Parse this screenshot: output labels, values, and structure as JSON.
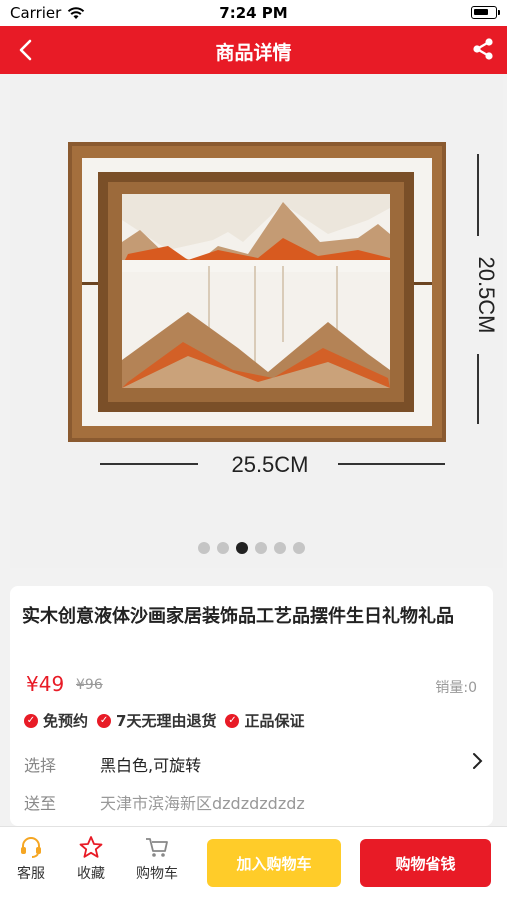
{
  "status_bar": {
    "carrier": "Carrier",
    "time": "7:24 PM"
  },
  "navbar": {
    "title": "商品详情",
    "back_icon": "chevron-left-icon",
    "share_icon": "share-icon"
  },
  "gallery": {
    "height_label": "20.5CM",
    "width_label": "25.5CM",
    "image_count": 6,
    "active_index": 2
  },
  "product": {
    "title": "实木创意液体沙画家居装饰品工艺品摆件生日礼物礼品",
    "price": "¥49",
    "original_price": "¥96",
    "sales": "销量:0",
    "badges": [
      "免预约",
      "7天无理由退货",
      "正品保证"
    ],
    "select_label": "选择",
    "select_value": "黑白色,可旋转",
    "ship_label": "送至",
    "ship_value": "天津市滨海新区dzdzdzdzdz"
  },
  "tabbar": {
    "service": "客服",
    "favorite": "收藏",
    "cart": "购物车",
    "add_to_cart": "加入购物车",
    "buy": "购物省钱"
  },
  "colors": {
    "brand_red": "#e81b26",
    "cart_yellow": "#ffcc29"
  }
}
